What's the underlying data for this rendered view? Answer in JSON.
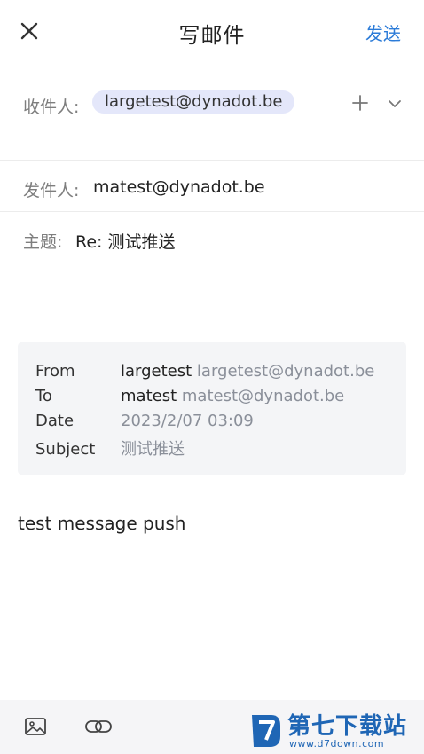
{
  "header": {
    "close_icon": "close-icon",
    "title": "写邮件",
    "send_label": "发送"
  },
  "compose": {
    "to_label": "收件人:",
    "to_chip": "largetest@dynadot.be",
    "from_label": "发件人:",
    "from_value": "matest@dynadot.be",
    "subject_label": "主题:",
    "subject_value": "Re: 测试推送"
  },
  "quoted": {
    "from_key": "From",
    "from_name": "largetest",
    "from_email": "largetest@dynadot.be",
    "to_key": "To",
    "to_name": "matest",
    "to_email": "matest@dynadot.be",
    "date_key": "Date",
    "date_value": "2023/2/07 03:09",
    "subject_key": "Subject",
    "subject_value": "测试推送"
  },
  "body": {
    "text": "test message push"
  },
  "toolbar": {
    "image_icon": "image-icon",
    "link_icon": "link-icon"
  },
  "watermark": {
    "title": "第七下载站",
    "url": "www.d7down.com"
  },
  "colors": {
    "accent": "#2b7bd8",
    "chip_bg": "#e4e7fa",
    "quote_bg": "#f4f5f7",
    "watermark": "#1f66b5"
  }
}
